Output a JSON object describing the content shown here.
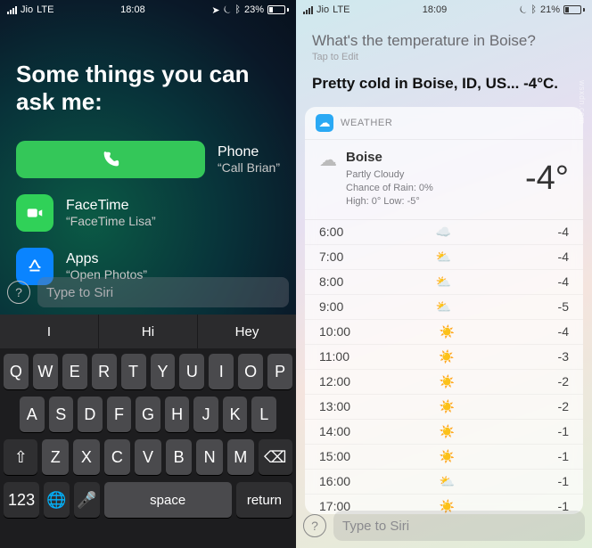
{
  "left": {
    "status": {
      "carrier": "Jio",
      "net": "LTE",
      "time": "18:08",
      "battery_pct": "23%",
      "battery_fill": 23
    },
    "heading": "Some things you can ask me:",
    "suggestions": [
      {
        "icon": "phone",
        "title": "Phone",
        "example": "“Call Brian”"
      },
      {
        "icon": "facetime",
        "title": "FaceTime",
        "example": "“FaceTime Lisa”"
      },
      {
        "icon": "apps",
        "title": "Apps",
        "example": "“Open Photos”"
      }
    ],
    "input_placeholder": "Type to Siri",
    "predictions": [
      "I",
      "Hi",
      "Hey"
    ],
    "keyboard": {
      "row1": [
        "Q",
        "W",
        "E",
        "R",
        "T",
        "Y",
        "U",
        "I",
        "O",
        "P"
      ],
      "row2": [
        "A",
        "S",
        "D",
        "F",
        "G",
        "H",
        "J",
        "K",
        "L"
      ],
      "row3": [
        "Z",
        "X",
        "C",
        "V",
        "B",
        "N",
        "M"
      ],
      "shift": "⇧",
      "backspace": "⌫",
      "numbers": "123",
      "globe": "🌐",
      "mic": "🎙",
      "space": "space",
      "return": "return"
    }
  },
  "right": {
    "status": {
      "carrier": "Jio",
      "net": "LTE",
      "time": "18:09",
      "battery_pct": "21%",
      "battery_fill": 21
    },
    "question": "What's the temperature in Boise?",
    "tap_edit": "Tap to Edit",
    "answer": "Pretty cold in Boise, ID, US... -4°C.",
    "card": {
      "app_label": "WEATHER",
      "city": "Boise",
      "cond": "Partly Cloudy",
      "rain": "Chance of Rain: 0%",
      "hilo": "High: 0° Low: -5°",
      "temp": "-4°"
    },
    "hourly": [
      {
        "time": "6:00",
        "icon": "☁️",
        "temp": "-4"
      },
      {
        "time": "7:00",
        "icon": "⛅",
        "temp": "-4"
      },
      {
        "time": "8:00",
        "icon": "⛅",
        "temp": "-4"
      },
      {
        "time": "9:00",
        "icon": "⛅",
        "temp": "-5"
      },
      {
        "time": "10:00",
        "icon": "☀️",
        "temp": "-4"
      },
      {
        "time": "11:00",
        "icon": "☀️",
        "temp": "-3"
      },
      {
        "time": "12:00",
        "icon": "☀️",
        "temp": "-2"
      },
      {
        "time": "13:00",
        "icon": "☀️",
        "temp": "-2"
      },
      {
        "time": "14:00",
        "icon": "☀️",
        "temp": "-1"
      },
      {
        "time": "15:00",
        "icon": "☀️",
        "temp": "-1"
      },
      {
        "time": "16:00",
        "icon": "⛅",
        "temp": "-1"
      },
      {
        "time": "17:00",
        "icon": "☀️",
        "temp": "-1"
      }
    ],
    "input_placeholder": "Type to Siri"
  },
  "watermark": "wsxdn.com",
  "icons": {
    "phone": "☎︎",
    "facetime": "■",
    "apps": "A",
    "weather": "☁",
    "help": "?",
    "location": "➤",
    "alarm": "⏰",
    "bt": "\""
  }
}
